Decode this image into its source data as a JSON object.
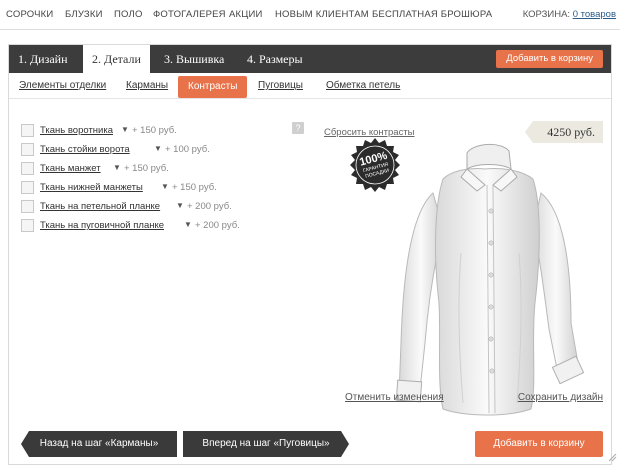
{
  "topnav": {
    "items": [
      "СОРОЧКИ",
      "БЛУЗКИ",
      "ПОЛО",
      "ФОТОГАЛЕРЕЯ",
      "АКЦИИ",
      "НОВЫМ КЛИЕНТАМ",
      "БЕСПЛАТНАЯ БРОШЮРА"
    ],
    "cart_label": "КОРЗИНА:",
    "cart_link": "0 товаров"
  },
  "steps": {
    "items": [
      "1. Дизайн",
      "2. Детали",
      "3. Вышивка",
      "4. Размеры"
    ],
    "active_index": 1,
    "add_to_cart": "Добавить в корзину"
  },
  "subtabs": {
    "items": [
      "Элементы отделки",
      "Карманы",
      "Контрасты",
      "Пуговицы",
      "Обметка петель"
    ],
    "active_index": 2
  },
  "options": [
    {
      "label": "Ткань воротника",
      "price": "+ 150 руб."
    },
    {
      "label": "Ткань стойки ворота",
      "price": "+ 100 руб."
    },
    {
      "label": "Ткань манжет",
      "price": "+ 150 руб."
    },
    {
      "label": "Ткань нижней манжеты",
      "price": "+ 150 руб."
    },
    {
      "label": "Ткань на петельной планке",
      "price": "+ 200 руб."
    },
    {
      "label": "Ткань на пуговичной планке",
      "price": "+ 200 руб."
    }
  ],
  "help_icon": "?",
  "reset_link": "Сбросить контрасты",
  "price": "4250 руб.",
  "badge": {
    "line1": "100%",
    "line2": "ГАРАНТИЯ",
    "line3": "ПОСАДКИ"
  },
  "cancel_link": "Отменить изменения",
  "save_link": "Сохранить дизайн",
  "buttons": {
    "back": "Назад на шаг «Карманы»",
    "next": "Вперед на шаг «Пуговицы»",
    "add": "Добавить в корзину"
  },
  "colors": {
    "accent": "#e8734b",
    "dark": "#3c3c3c"
  }
}
